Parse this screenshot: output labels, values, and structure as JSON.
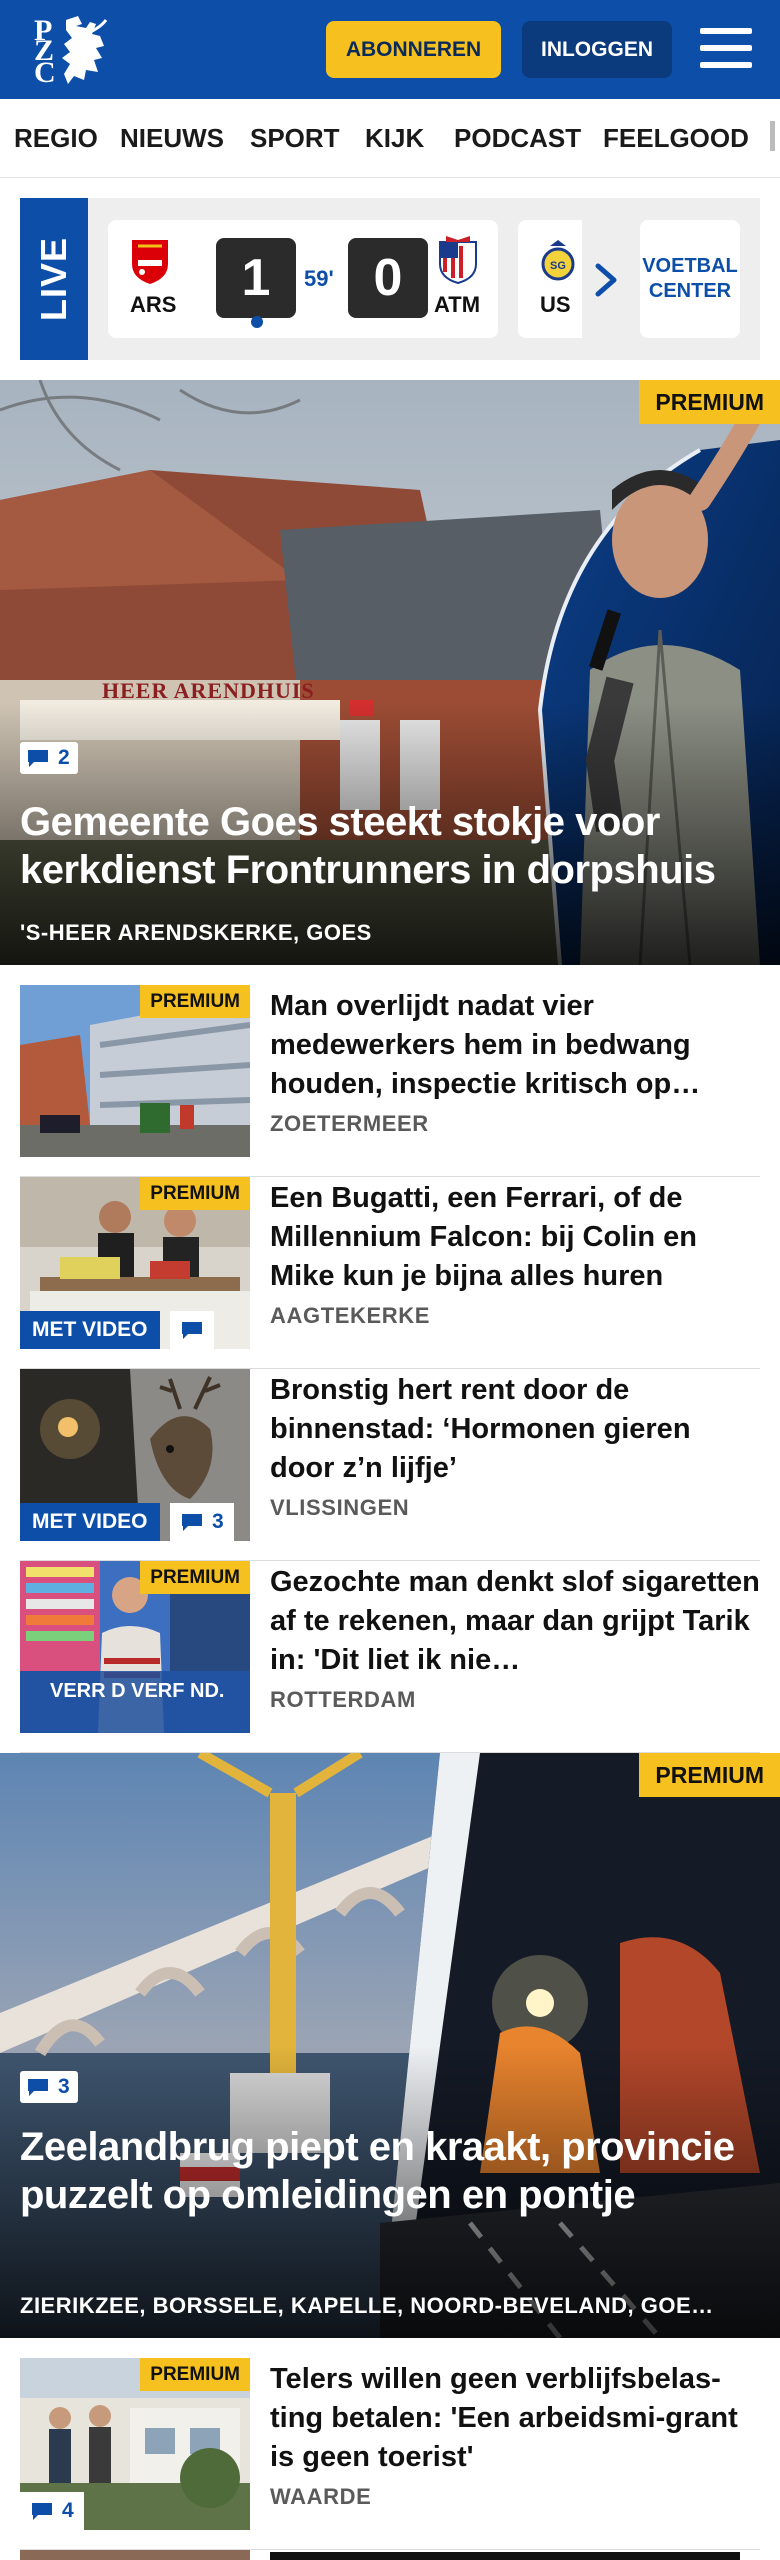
{
  "header": {
    "logo_letters": [
      "P",
      "Z",
      "C"
    ],
    "subscribe_label": "ABONNEREN",
    "login_label": "INLOGGEN"
  },
  "nav": {
    "items": [
      "REGIO",
      "NIEUWS",
      "SPORT",
      "KIJK",
      "PODCAST",
      "FEELGOOD"
    ]
  },
  "live": {
    "tag": "LIVE",
    "match": {
      "home_code": "ARS",
      "away_code": "ATM",
      "home_score": "1",
      "away_score": "0",
      "minute": "59'"
    },
    "next_match_code": "US",
    "voetbal_center_label": "VOETBAL CENTER"
  },
  "premium_label": "PREMIUM",
  "video_label": "MET VIDEO",
  "hero1": {
    "title": "Gemeente Goes steekt stokje voor kerkdienst Frontrunners in dorpshuis",
    "location": "'S-HEER ARENDSKERKE, GOES",
    "comments": "2",
    "sign_text": "HEER ARENDHUIS"
  },
  "articles": [
    {
      "title": "Man overlijdt nadat vier medewerkers hem in bedwang houden, inspectie kritisch op…",
      "location": "ZOETERMEER"
    },
    {
      "title": "Een Bugatti, een Ferrari, of de Millennium Falcon: bij Colin en Mike kun je bijna alles huren",
      "location": "AAGTEKERKE"
    },
    {
      "title": "Bronstig hert rent door de binnenstad: ‘Hormonen gieren door z’n lijfje’",
      "location": "VLISSINGEN",
      "comments": "3"
    },
    {
      "title": "Gezochte man denkt slof sigaretten af te rekenen, maar dan grijpt Tarik in: 'Dit liet ik nie…",
      "location": "ROTTERDAM",
      "thumb_text": "VERR   D VERF   ND."
    }
  ],
  "hero2": {
    "title": "Zeelandbrug piept en kraakt, provincie puzzelt op omleidingen en pontje",
    "location": "ZIERIKZEE, BORSSELE, KAPELLE, NOORD-BEVELAND, GOE…",
    "comments": "3"
  },
  "article5": {
    "title": "Telers willen geen verblijfsbelas-ting betalen: 'Een arbeidsmi-grant is geen toerist'",
    "location": "WAARDE",
    "comments": "4"
  },
  "colors": {
    "brand_blue": "#0d4fa8",
    "premium_yellow": "#f6c01e"
  }
}
